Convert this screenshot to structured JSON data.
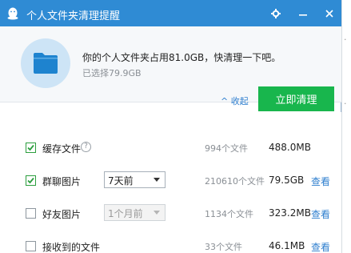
{
  "window": {
    "title": "个人文件夹清理提醒"
  },
  "header": {
    "message": "你的个人文件夹占用81.0GB，快清理一下吧。",
    "selected": "已选择79.9GB",
    "collapse_label": "^ 收起",
    "clean_button": "立即清理"
  },
  "rows": [
    {
      "label": "缓存文件",
      "checked": true,
      "count": "994个文件",
      "size": "488.0MB",
      "view": ""
    },
    {
      "label": "群聊图片",
      "checked": true,
      "select": "7天前",
      "count": "210610个文件",
      "size": "79.5GB",
      "view": "查看"
    },
    {
      "label": "好友图片",
      "checked": false,
      "select": "1个月前",
      "count": "1134个文件",
      "size": "323.2MB",
      "view": "查看"
    },
    {
      "label": "接收到的文件",
      "checked": false,
      "count": "33个文件",
      "size": "46.1MB",
      "view": "查看"
    }
  ],
  "colors": {
    "titlebar": "#2f8bd4",
    "clean_button": "#18b64d",
    "link": "#2f7fcf"
  },
  "icons": {
    "logo": "qq-penguin-icon",
    "settings": "gear-icon",
    "minimize": "minimize-icon",
    "close": "close-icon",
    "folder": "folder-icon",
    "help": "question-icon"
  }
}
